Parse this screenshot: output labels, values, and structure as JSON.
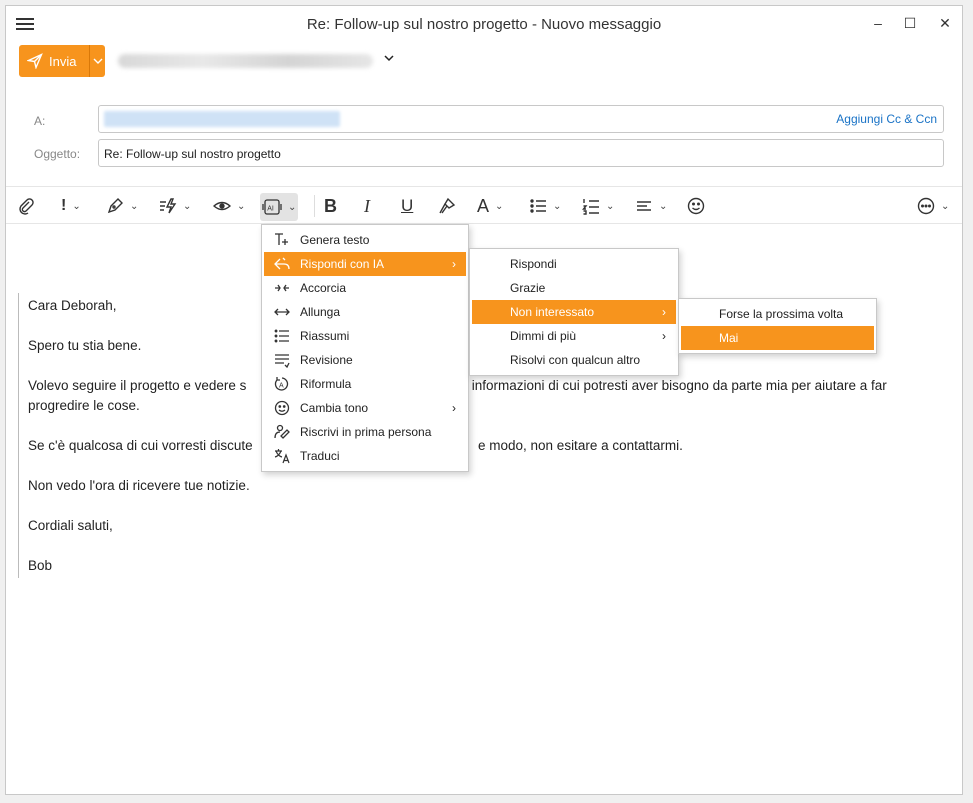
{
  "window": {
    "title": "Re: Follow-up sul nostro progetto - Nuovo messaggio",
    "minimize": "–",
    "maximize": "☐",
    "close": "✕"
  },
  "compose": {
    "send_label": "Invia",
    "to_label": "A:",
    "add_cc_label": "Aggiungi Cc & Ccn",
    "subject_label": "Oggetto:",
    "subject_value": "Re: Follow-up sul nostro progetto"
  },
  "toolbar": {
    "bold": "B",
    "italic": "I",
    "underline": "U",
    "font": "A",
    "priority": "!"
  },
  "body": {
    "paragraphs": [
      "Cara Deborah,",
      "Spero tu stia bene.",
      "Volevo seguire il progetto e vedere s",
      "progredire le cose.",
      "Se c'è qualcosa di cui vorresti discute",
      "Non vedo l'ora di ricevere tue notizie.",
      "Cordiali saluti,",
      "Bob"
    ],
    "fragment_line3": "ori informazioni di cui potresti aver bisogno da parte mia per aiutare a far",
    "fragment_line5": "e modo, non esitare a contattarmi."
  },
  "ai_menu": {
    "items": [
      {
        "label": "Genera testo",
        "icon": "generate-text-icon"
      },
      {
        "label": "Rispondi con IA",
        "icon": "reply-ai-icon",
        "submenu": true,
        "highlighted": true
      },
      {
        "label": "Accorcia",
        "icon": "shorten-icon"
      },
      {
        "label": "Allunga",
        "icon": "lengthen-icon"
      },
      {
        "label": "Riassumi",
        "icon": "summarize-icon"
      },
      {
        "label": "Revisione",
        "icon": "review-icon"
      },
      {
        "label": "Riformula",
        "icon": "rephrase-icon"
      },
      {
        "label": "Cambia tono",
        "icon": "smiley-icon",
        "submenu": true
      },
      {
        "label": "Riscrivi in prima persona",
        "icon": "first-person-icon"
      },
      {
        "label": "Traduci",
        "icon": "translate-icon"
      }
    ]
  },
  "reply_menu": {
    "items": [
      {
        "label": "Rispondi"
      },
      {
        "label": "Grazie"
      },
      {
        "label": "Non interessato",
        "submenu": true,
        "highlighted": true
      },
      {
        "label": "Dimmi di più",
        "submenu": true
      },
      {
        "label": "Risolvi con qualcun altro"
      }
    ]
  },
  "not_interested_menu": {
    "items": [
      {
        "label": "Forse la prossima volta"
      },
      {
        "label": "Mai",
        "highlighted": true
      }
    ]
  },
  "colors": {
    "accent": "#f7941d",
    "link": "#1a73c6"
  }
}
